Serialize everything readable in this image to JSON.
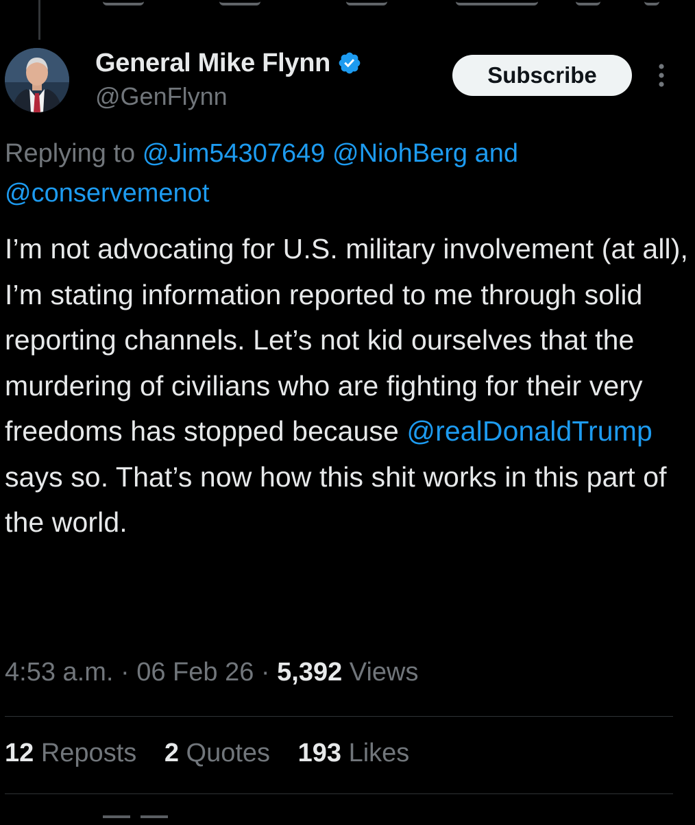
{
  "author": {
    "display_name": "General Mike Flynn",
    "handle": "@GenFlynn",
    "verified": true,
    "verified_color": "#1d9bf0"
  },
  "actions": {
    "subscribe_label": "Subscribe",
    "more_icon": "more-vertical-icon"
  },
  "reply": {
    "prefix": "Replying to",
    "mention_1": "@Jim54307649",
    "mention_2": "@NiohBerg",
    "joiner": "and",
    "mention_3": "@conservemenot"
  },
  "tweet": {
    "text_before": "I’m not advocating for U.S. military involvement (at all), I’m stating information reported to me through solid reporting channels. Let’s not kid ourselves that the murdering of civilians who are fighting for their very freedoms has stopped because",
    "mention": "@realDonaldTrump",
    "text_after": "says so. That’s now how this shit works in this part of the world."
  },
  "meta": {
    "time": "4:53 a.m.",
    "date": "06 Feb 26",
    "views_count": "5,392",
    "views_label": "Views"
  },
  "stats": {
    "reposts_count": "12",
    "reposts_label": "Reposts",
    "quotes_count": "2",
    "quotes_label": "Quotes",
    "likes_count": "193",
    "likes_label": "Likes"
  },
  "colors": {
    "background": "#000000",
    "text": "#e7e9ea",
    "secondary": "#71767b",
    "link": "#1d9bf0"
  }
}
